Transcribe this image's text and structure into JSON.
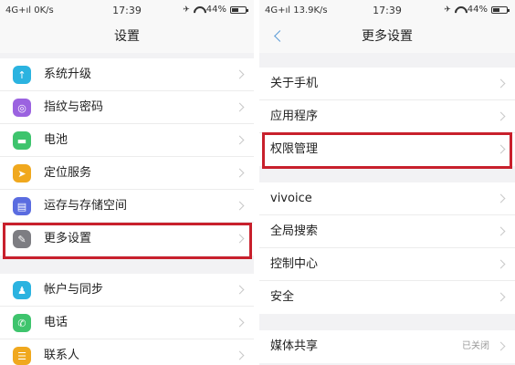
{
  "left_screen": {
    "status": {
      "network": "4G+ıl",
      "speed": "0K/s",
      "time": "17:39",
      "battery": "44%"
    },
    "title": "设置",
    "items": [
      {
        "label": "系统升级",
        "icon": "system-upgrade-icon"
      },
      {
        "label": "指纹与密码",
        "icon": "fingerprint-icon"
      },
      {
        "label": "电池",
        "icon": "battery-icon"
      },
      {
        "label": "定位服务",
        "icon": "location-icon"
      },
      {
        "label": "运存与存储空间",
        "icon": "storage-icon"
      },
      {
        "label": "更多设置",
        "icon": "wrench-icon",
        "highlighted": true
      },
      {
        "label": "帐户与同步",
        "icon": "account-icon"
      },
      {
        "label": "电话",
        "icon": "phone-icon"
      },
      {
        "label": "联系人",
        "icon": "contacts-icon"
      }
    ]
  },
  "right_screen": {
    "status": {
      "network": "4G+ıl",
      "speed": "13.9K/s",
      "time": "17:39",
      "battery": "44%"
    },
    "title": "更多设置",
    "items": [
      {
        "label": "关于手机"
      },
      {
        "label": "应用程序"
      },
      {
        "label": "权限管理",
        "highlighted": true
      },
      {
        "label": "vivoice"
      },
      {
        "label": "全局搜索"
      },
      {
        "label": "控制中心"
      },
      {
        "label": "安全"
      },
      {
        "label": "媒体共享",
        "value": "已关闭"
      }
    ]
  },
  "colors": {
    "highlight_border": "#c8202c",
    "back_arrow": "#5c9bd6"
  }
}
